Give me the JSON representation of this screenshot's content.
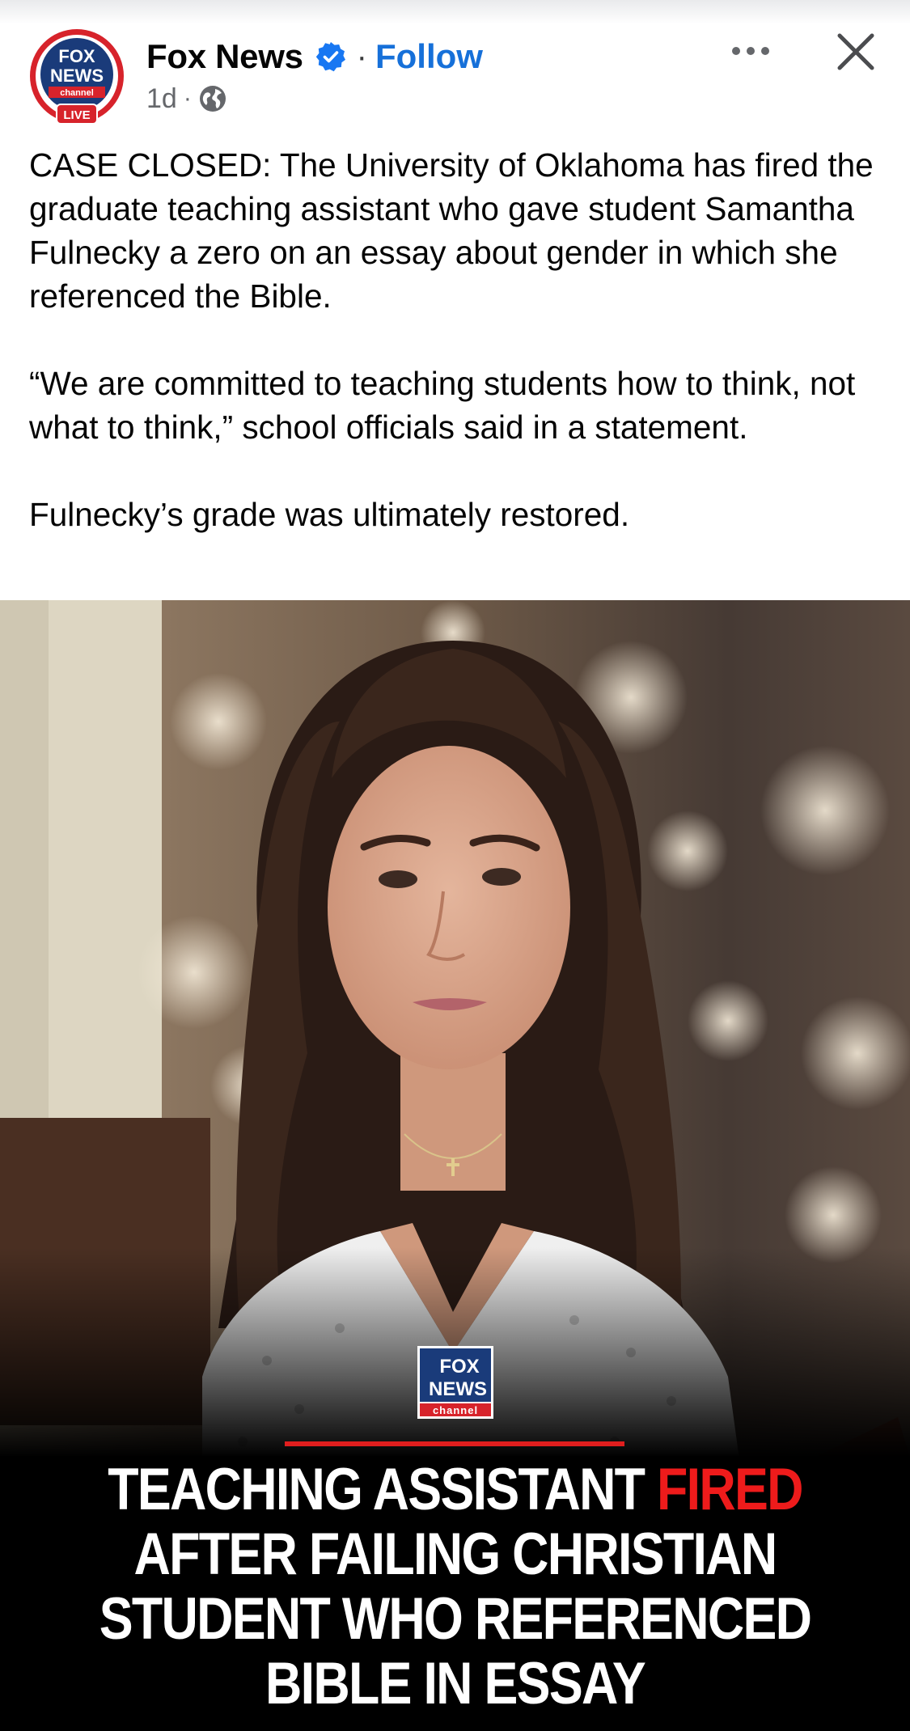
{
  "header": {
    "page_name": "Fox News",
    "follow_label": "Follow",
    "separator": "·",
    "time": "1d",
    "meta_separator": "·",
    "verified_icon": "verified-badge-icon",
    "audience_icon": "globe-icon",
    "more_icon": "more-options-icon",
    "close_icon": "close-icon",
    "avatar": {
      "line1": "FOX",
      "line2": "NEWS",
      "line3": "channel",
      "badge": "LIVE"
    }
  },
  "caption": {
    "paragraph1": "CASE CLOSED: The University of Oklahoma has fired the graduate teaching assistant who gave student Samantha Fulnecky a zero on an essay about gender in which she referenced the Bible.",
    "paragraph2": "“We are committed to teaching students how to think, not what to think,” school officials said in a statement.",
    "paragraph3": "Fulnecky’s grade was ultimately restored."
  },
  "image": {
    "logo": {
      "line1": "FOX",
      "line2": "NEWS",
      "line3": "channel"
    },
    "headline": {
      "part1": "TEACHING ASSISTANT ",
      "highlight": "FIRED",
      "part2": " AFTER FAILING CHRISTIAN STUDENT WHO REFERENCED BIBLE IN ESSAY"
    }
  },
  "colors": {
    "accent_blue": "#1670d9",
    "brand_red": "#e01e1e",
    "fox_blue": "#1a3b7a"
  }
}
